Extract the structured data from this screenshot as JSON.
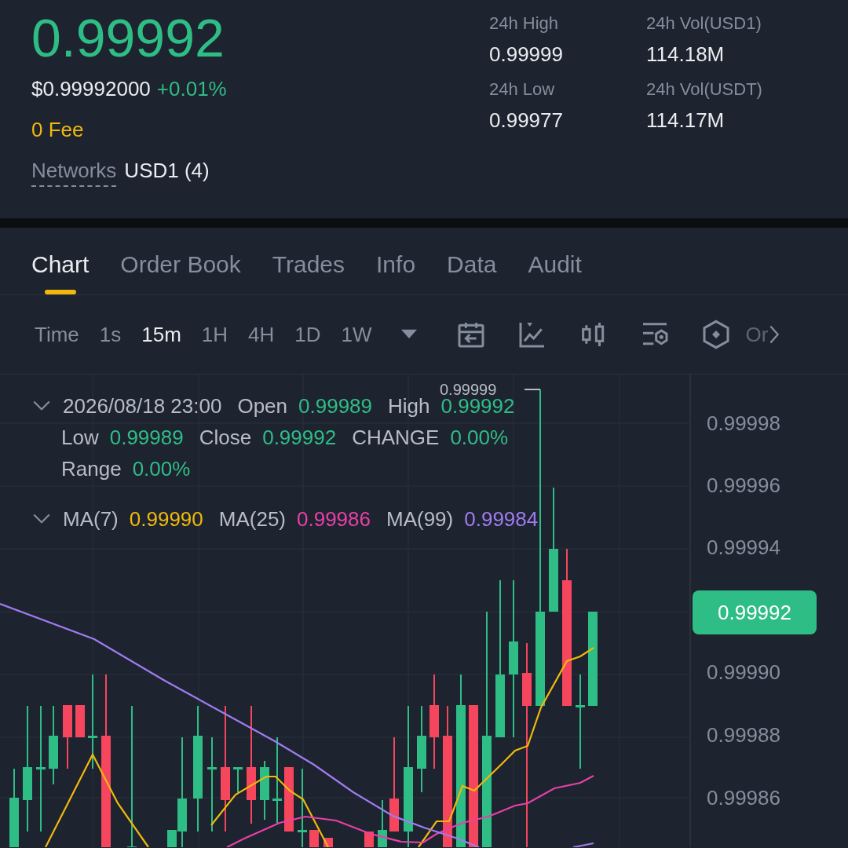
{
  "ticker": {
    "last_price": "0.99992",
    "usd_price": "$0.99992000",
    "change": "+0.01%",
    "fee": "0 Fee",
    "networks_label": "Networks",
    "networks_value": "USD1 (4)"
  },
  "stats": [
    {
      "label": "24h High",
      "value": "0.99999"
    },
    {
      "label": "24h Vol(USD1)",
      "value": "114.18M"
    },
    {
      "label": "24h Low",
      "value": "0.99977"
    },
    {
      "label": "24h Vol(USDT)",
      "value": "114.17M"
    }
  ],
  "tabs": [
    {
      "label": "Chart",
      "selected": true
    },
    {
      "label": "Order Book",
      "selected": false
    },
    {
      "label": "Trades",
      "selected": false
    },
    {
      "label": "Info",
      "selected": false
    },
    {
      "label": "Data",
      "selected": false
    },
    {
      "label": "Audit",
      "selected": false
    }
  ],
  "toolbar": {
    "time_label": "Time",
    "intervals": [
      {
        "label": "1s",
        "selected": false
      },
      {
        "label": "15m",
        "selected": true
      },
      {
        "label": "1H",
        "selected": false
      },
      {
        "label": "4H",
        "selected": false
      },
      {
        "label": "1D",
        "selected": false
      },
      {
        "label": "1W",
        "selected": false
      }
    ],
    "more_label": "Or"
  },
  "chart": {
    "candle_info": {
      "time": "2026/08/18 23:00",
      "fields": [
        {
          "label": "Open",
          "value": "0.99989"
        },
        {
          "label": "High",
          "value": "0.99992"
        },
        {
          "label": "Low",
          "value": "0.99989"
        },
        {
          "label": "Close",
          "value": "0.99992"
        },
        {
          "label": "CHANGE",
          "value": "0.00%"
        },
        {
          "label": "Range",
          "value": "0.00%"
        }
      ]
    },
    "moving_averages": [
      {
        "label": "MA(7)",
        "value": "0.99990",
        "color": "#f0b90b"
      },
      {
        "label": "MA(25)",
        "value": "0.99986",
        "color": "#e840a8"
      },
      {
        "label": "MA(99)",
        "value": "0.99984",
        "color": "#a07cf0"
      }
    ],
    "high_marker": "0.99999",
    "y_axis_labels": [
      "0.99998",
      "0.99996",
      "0.99994",
      "0.99990",
      "0.99988",
      "0.99986"
    ],
    "current_price": "0.99992"
  }
}
